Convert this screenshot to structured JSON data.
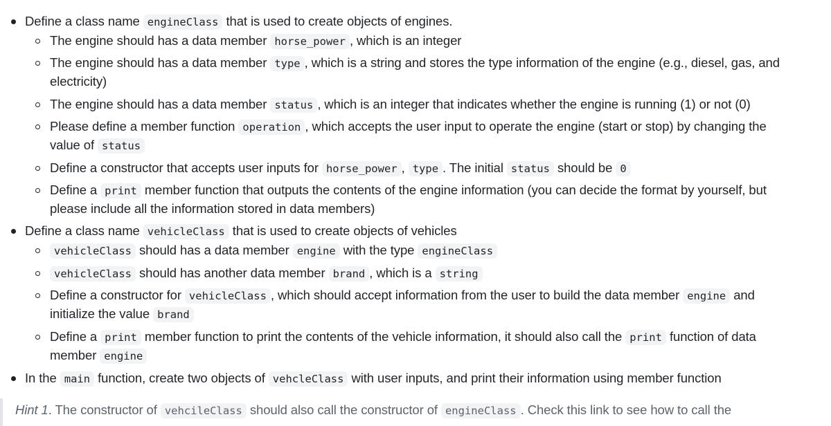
{
  "items": [
    {
      "parts": [
        "Define a class name ",
        {
          "code": "engineClass"
        },
        " that is used to create objects of engines."
      ],
      "subitems": [
        {
          "lines": [
            [
              "The engine should has a data member ",
              {
                "code": "horse_power"
              },
              ", which is an integer"
            ]
          ]
        },
        {
          "lines": [
            [
              "The engine should has a data member ",
              {
                "code": "type"
              },
              ", which is a string and stores the type information of the engine (e.g., diesel, gas, and"
            ],
            [
              "electricity)"
            ]
          ]
        },
        {
          "lines": [
            [
              "The engine should has a data member ",
              {
                "code": "status"
              },
              ", which is an integer that indicates whether the engine is running (1) or not (0)"
            ]
          ]
        },
        {
          "lines": [
            [
              "Please define a member function ",
              {
                "code": "operation"
              },
              ", which accepts the user input to operate the engine (start or stop) by changing the"
            ],
            [
              "value of ",
              {
                "code": "status"
              }
            ]
          ]
        },
        {
          "lines": [
            [
              "Define a constructor that accepts user inputs for ",
              {
                "code": "horse_power"
              },
              ", ",
              {
                "code": "type"
              },
              ". The initial ",
              {
                "code": "status"
              },
              " should be ",
              {
                "code": "0"
              }
            ]
          ]
        },
        {
          "lines": [
            [
              "Define a ",
              {
                "code": "print"
              },
              " member function that outputs the contents of the engine information (you can decide the format by yourself, but"
            ],
            [
              "please include all the information stored in data members)"
            ]
          ]
        }
      ]
    },
    {
      "parts": [
        "Define a class name ",
        {
          "code": "vehicleClass"
        },
        " that is used to create objects of vehicles"
      ],
      "subitems": [
        {
          "lines": [
            [
              {
                "code": "vehicleClass"
              },
              " should has a data member ",
              {
                "code": "engine"
              },
              " with the type ",
              {
                "code": "engineClass"
              }
            ]
          ]
        },
        {
          "lines": [
            [
              {
                "code": "vehicleClass"
              },
              " should has another data member ",
              {
                "code": "brand"
              },
              ", which is a ",
              {
                "code": "string"
              }
            ]
          ]
        },
        {
          "lines": [
            [
              "Define a constructor for ",
              {
                "code": "vehicleClass"
              },
              ", which should accept information from the user to build the data member ",
              {
                "code": "engine"
              },
              " and"
            ],
            [
              "initialize the value ",
              {
                "code": "brand"
              }
            ]
          ]
        },
        {
          "lines": [
            [
              "Define a ",
              {
                "code": "print"
              },
              " member function to print the contents of the vehicle information, it should also call the ",
              {
                "code": "print"
              },
              " function of data"
            ],
            [
              "member ",
              {
                "code": "engine"
              }
            ]
          ]
        }
      ]
    },
    {
      "parts": [
        "In the ",
        {
          "code": "main"
        },
        " function, create two objects of ",
        {
          "code": "vehcleClass"
        },
        " with user inputs, and print their information using member function"
      ],
      "subitems": []
    }
  ],
  "hint": {
    "label": "Hint 1",
    "parts": [
      ". The constructor of ",
      {
        "code": "vehcileClass"
      },
      " should also call the constructor of ",
      {
        "code": "engineClass"
      },
      ". Check this link to see how to call the"
    ]
  }
}
